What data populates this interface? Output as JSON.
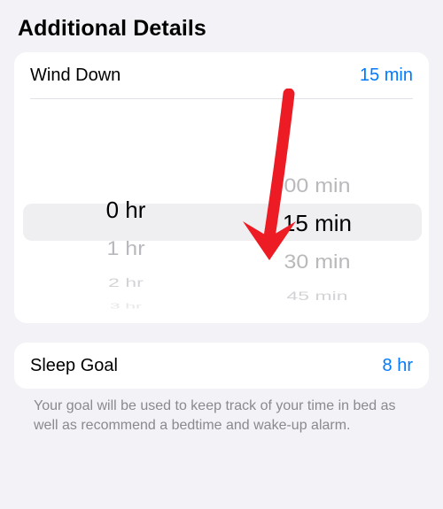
{
  "section_title": "Additional Details",
  "wind_down": {
    "label": "Wind Down",
    "value": "15 min",
    "picker": {
      "hours": {
        "selected": "0 hr",
        "below": [
          "1 hr",
          "2 hr",
          "3 hr"
        ]
      },
      "minutes": {
        "above": [
          "00 min"
        ],
        "selected": "15 min",
        "below": [
          "30 min",
          "45 min"
        ]
      }
    }
  },
  "sleep_goal": {
    "label": "Sleep Goal",
    "value": "8 hr",
    "note": "Your goal will be used to keep track of your time in bed as well as recommend a bedtime and wake-up alarm."
  },
  "colors": {
    "accent": "#007aff",
    "arrow": "#ed1c24"
  }
}
